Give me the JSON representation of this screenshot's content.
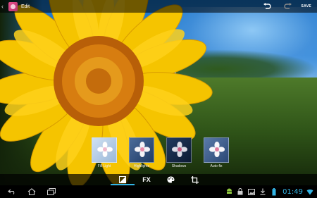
{
  "top_bar": {
    "title": "Edit",
    "save_label": "SAVE"
  },
  "filters": [
    {
      "label": "Fill Light"
    },
    {
      "label": "Highlights"
    },
    {
      "label": "Shadows"
    },
    {
      "label": "Auto-fix"
    }
  ],
  "tabs": [
    {
      "id": "tone",
      "icon": "tone-icon",
      "active": true
    },
    {
      "id": "fx",
      "label": "FX",
      "active": false
    },
    {
      "id": "color",
      "icon": "palette-icon",
      "active": false
    },
    {
      "id": "crop",
      "icon": "crop-icon",
      "active": false
    }
  ],
  "status_bar": {
    "clock": "01:49"
  },
  "colors": {
    "accent": "#33b5e5",
    "bar_background": "#000000",
    "petal": "#f7c600",
    "flower_center": "#c96a0a"
  }
}
